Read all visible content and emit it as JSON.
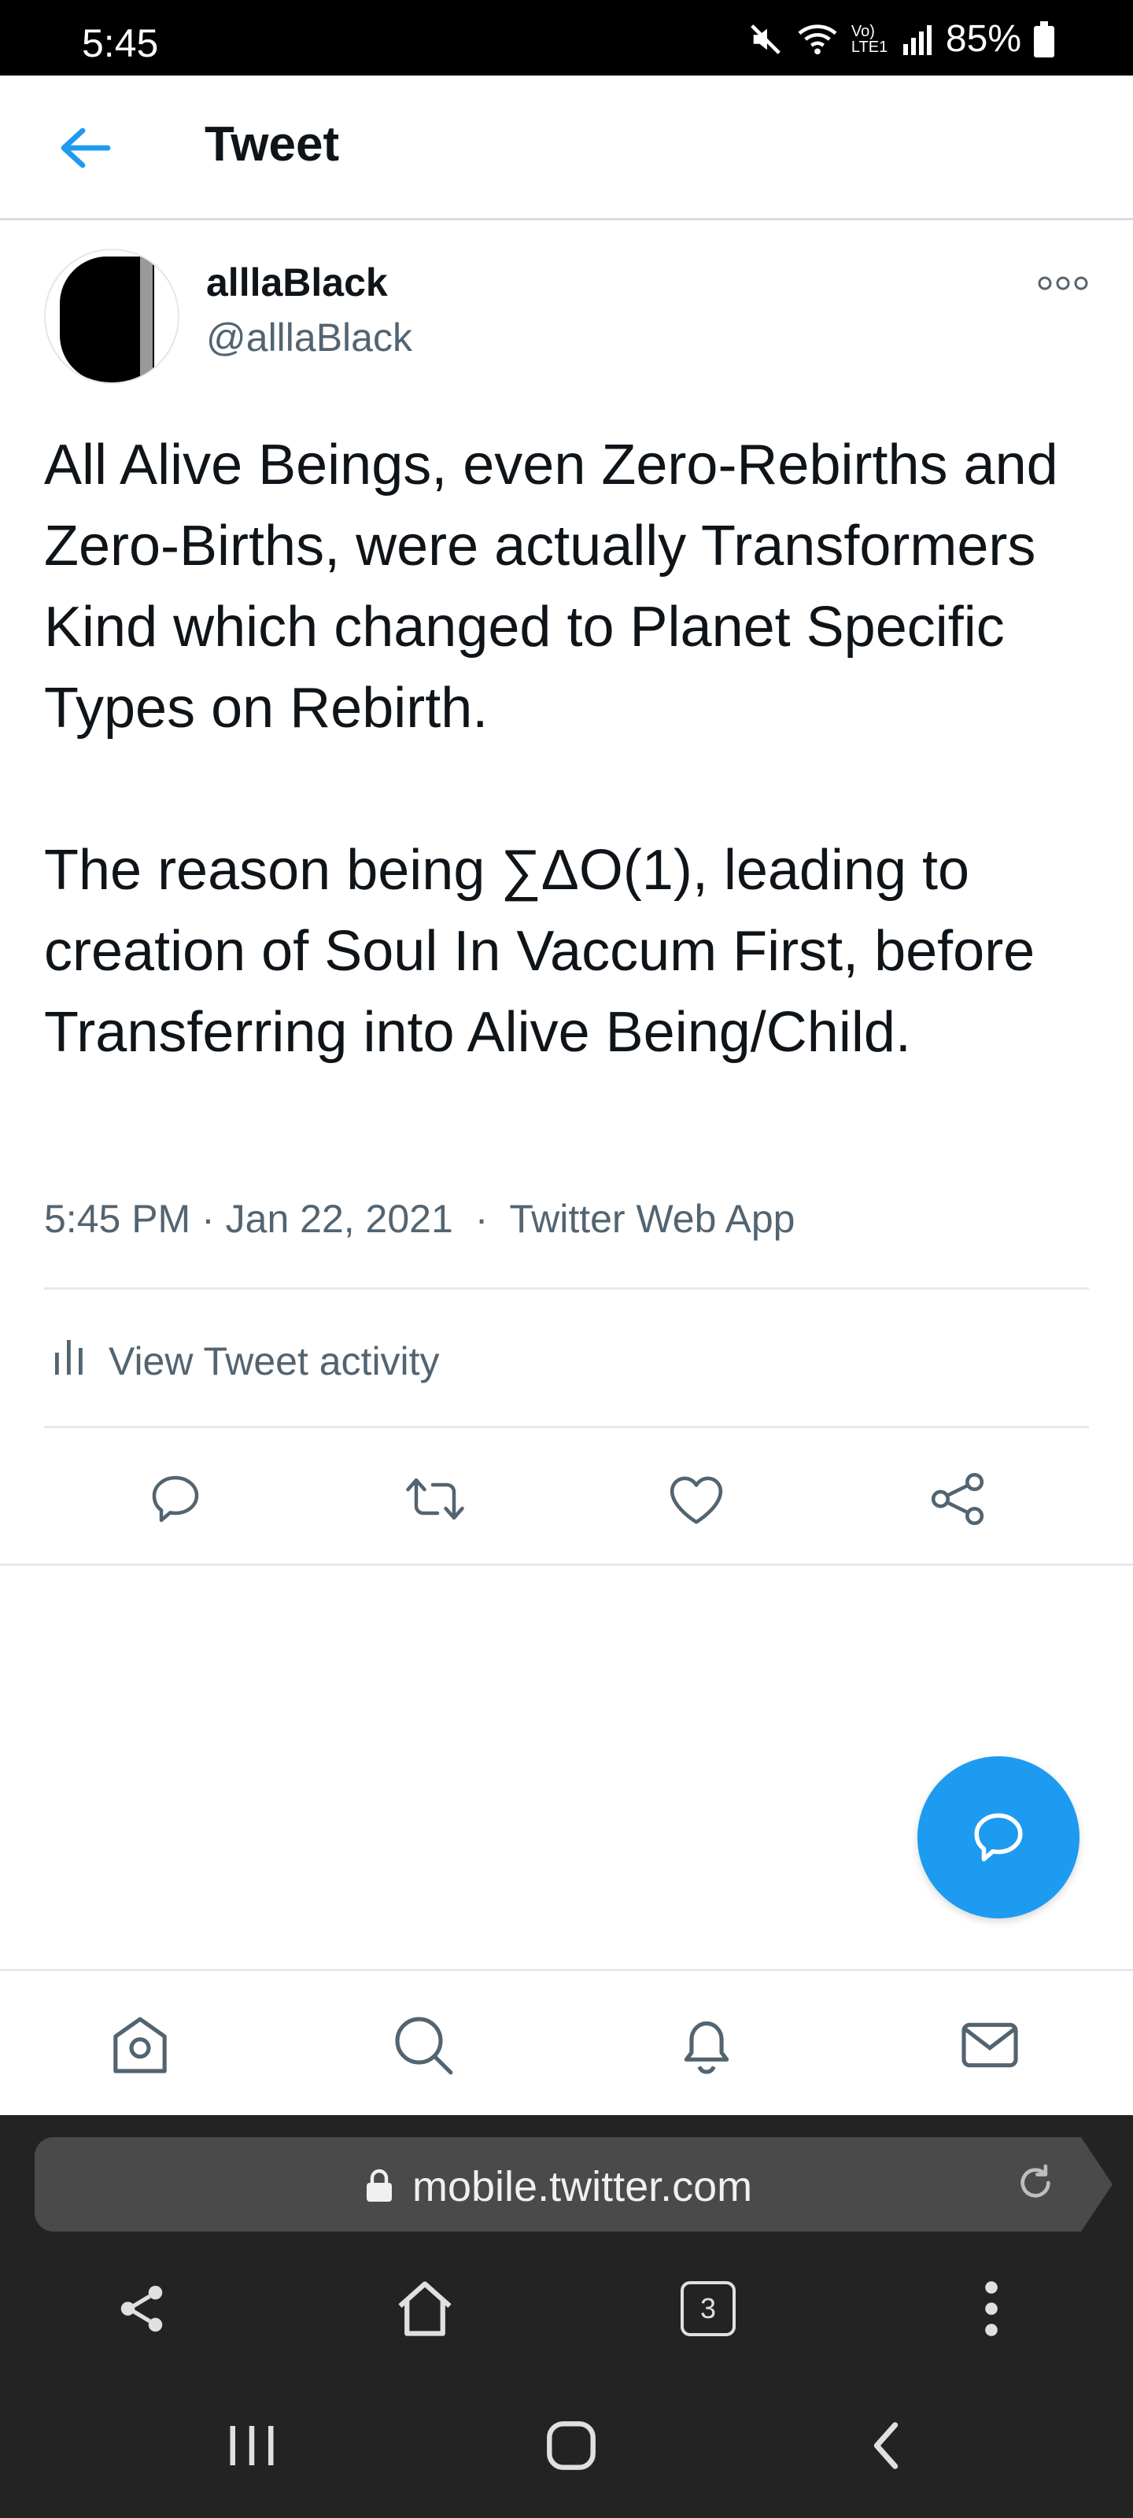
{
  "status_bar": {
    "time": "5:45",
    "network": "Vo) LTE1",
    "battery": "85%"
  },
  "header": {
    "title": "Tweet",
    "back_icon": "arrow-left-icon"
  },
  "tweet": {
    "display_name": "alllaBlack",
    "handle": "@alllaBlack",
    "paragraph1": "All Alive Beings, even Zero-Rebirths and Zero-Births, were actually Transformers Kind which changed to Planet Specific Types on Rebirth.",
    "paragraph2": "The reason being ∑ΔO(1), leading to creation of Soul In Vaccum First, before Transferring into Alive Being/Child.",
    "timestamp": "5:45 PM · Jan 22, 2021",
    "separator": "·",
    "source": "Twitter Web App",
    "activity_label": "View Tweet activity"
  },
  "actions": [
    "reply-icon",
    "retweet-icon",
    "like-icon",
    "share-icon"
  ],
  "bottom_nav": [
    "home-icon",
    "search-icon",
    "notifications-icon",
    "messages-icon"
  ],
  "browser": {
    "url": "mobile.twitter.com",
    "tab_count": "3"
  },
  "colors": {
    "accent": "#1d9bf0",
    "secondary_text": "#536471",
    "primary_text": "#0f1419",
    "browser_bg": "#232323"
  }
}
